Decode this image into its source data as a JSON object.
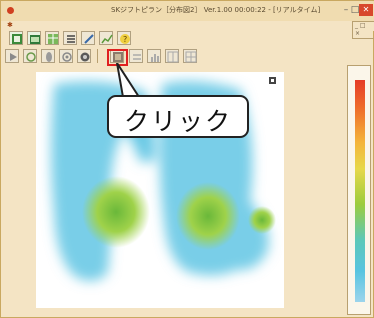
{
  "window": {
    "title": "SKジフトピラン［分布図2］ Ver.1.00  00:00:22 - [リアルタイム]",
    "menu_marker": "✱",
    "menu_right": "_ □ ×",
    "controls": {
      "minimize": "–",
      "maximize": "□",
      "close": "✕"
    }
  },
  "toolbar_row1": [
    {
      "name": "grid-view-icon",
      "color": "#3a8a3a"
    },
    {
      "name": "open-file-icon",
      "color": "#3a8a3a"
    },
    {
      "name": "table-icon",
      "color": "#6aa84a"
    },
    {
      "name": "list-icon",
      "color": "#555555"
    },
    {
      "name": "pen-icon",
      "color": "#3a6aa8"
    },
    {
      "name": "chart-icon",
      "color": "#5a9a3a"
    },
    {
      "name": "help-icon",
      "color": "#e0b020"
    }
  ],
  "toolbar_row2": [
    {
      "name": "play-icon"
    },
    {
      "name": "rotate-icon"
    },
    {
      "name": "foot-icon"
    },
    {
      "name": "cycle-icon"
    },
    {
      "name": "camera-icon"
    },
    {
      "name": "heatmap-view-icon"
    },
    {
      "name": "equalize-icon"
    },
    {
      "name": "bar-chart-icon"
    },
    {
      "name": "split-view-icon"
    },
    {
      "name": "grid-icon"
    }
  ],
  "callout": {
    "text": "クリック"
  },
  "scale": {
    "top_label": "",
    "bottom_label": ""
  },
  "colors": {
    "highlight": "#e02020",
    "heat_low": "#5ec8e8",
    "heat_mid": "#8ccf4a",
    "heat_high": "#6ab83a"
  }
}
